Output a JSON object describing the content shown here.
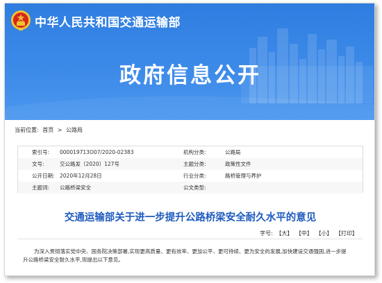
{
  "header": {
    "ministry_name": "中华人民共和国交通运输部",
    "banner_title": "政府信息公开"
  },
  "breadcrumb": {
    "label": "当前位置:",
    "items": [
      "首页",
      ">",
      "公路局"
    ]
  },
  "info": {
    "rows": [
      {
        "l1": "索引号:",
        "v1": "000019713O07/2020-02383",
        "l2": "机构分类:",
        "v2": "公路局"
      },
      {
        "l1": "文号:",
        "v1": "交公路发〔2020〕127号",
        "l2": "主题分类:",
        "v2": "政策性文件"
      },
      {
        "l1": "公开日期:",
        "v1": "2020年12月28日",
        "l2": "行业分类:",
        "v2": "路桥管理与养护"
      },
      {
        "l1": "主题词:",
        "v1": "公路桥梁安全",
        "l2": "公文类型:",
        "v2": ""
      }
    ]
  },
  "article": {
    "title": "交通运输部关于进一步提升公路桥梁安全耐久水平的意见",
    "font_label": "字号:",
    "font_options": [
      "【大】",
      "【中】",
      "【小】",
      "【打印】"
    ],
    "para_line1": "为深入贯彻落实党中央、国务院决策部署,实现更高质量、更有效率、更加公平、更可持续、更为安全的发展,加快建设交通强国,进一步提",
    "para_line2": "升公路桥梁安全耐久水平,现提出以下意见。"
  },
  "colors": {
    "banner": "#3c8ae8",
    "title_blue": "#1e5bbf",
    "emblem_red": "#d7261e",
    "emblem_gold": "#f2c230"
  }
}
